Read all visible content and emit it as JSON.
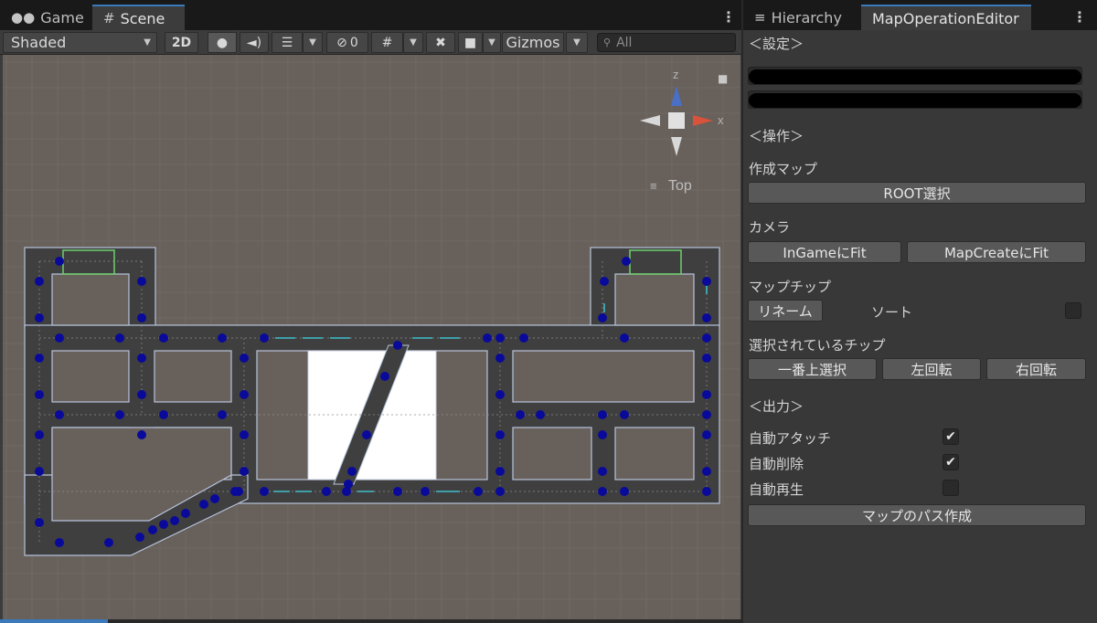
{
  "scene_window": {
    "tabs": [
      {
        "label": "Game",
        "icon": "gamepad-icon"
      },
      {
        "label": "Scene",
        "icon": "grid-icon"
      }
    ],
    "toolbar": {
      "shading_mode": "Shaded",
      "mode_2d": "2D",
      "hidden_count": "0",
      "gizmos": "Gizmos",
      "search_placeholder": "All"
    },
    "gizmo": {
      "axis_z": "z",
      "axis_x": "x",
      "view_label": "Top"
    }
  },
  "editor_window": {
    "tabs": [
      {
        "label": "Hierarchy",
        "icon": "list-icon"
      },
      {
        "label": "MapOperationEditor"
      }
    ],
    "sections": {
      "settings": "＜設定＞",
      "operations": "＜操作＞",
      "output": "＜出力＞"
    },
    "create_map": {
      "label": "作成マップ",
      "root_button": "ROOT選択"
    },
    "camera": {
      "label": "カメラ",
      "ingame_fit": "InGameにFit",
      "mapcreate_fit": "MapCreateにFit"
    },
    "map_chip": {
      "label": "マップチップ",
      "rename": "リネーム",
      "sort": "ソート",
      "sort_checked": false
    },
    "selected_chip": {
      "label": "選択されているチップ",
      "select_top": "一番上選択",
      "rotate_left": "左回転",
      "rotate_right": "右回転"
    },
    "output": {
      "auto_attach": {
        "label": "自動アタッチ",
        "checked": true
      },
      "auto_delete": {
        "label": "自動削除",
        "checked": true
      },
      "auto_play": {
        "label": "自動再生",
        "checked": false
      },
      "create_path": "マップのパス作成"
    }
  },
  "colors": {
    "accent": "#3a79bb",
    "scene_bg": "#68605b",
    "road": "#3f3f3f",
    "waypoint": "#0a0a9a",
    "arrow": "#3fd6e6"
  }
}
